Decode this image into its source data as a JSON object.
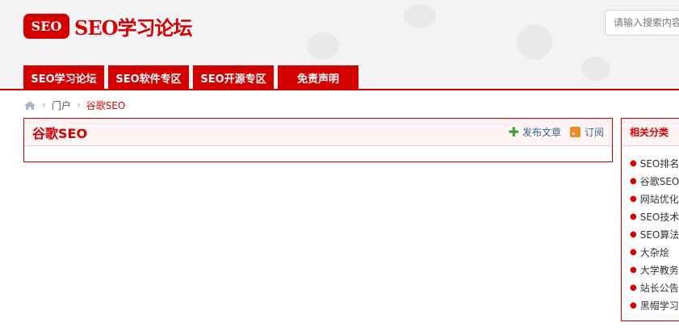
{
  "header": {
    "logo_badge": "SEO",
    "logo_text": "SEO学习论坛",
    "search_placeholder": "请输入搜索内容"
  },
  "nav": {
    "items": [
      {
        "label": "SEO学习论坛"
      },
      {
        "label": "SEO软件专区"
      },
      {
        "label": "SEO开源专区"
      },
      {
        "label": "免责声明"
      }
    ]
  },
  "breadcrumb": {
    "home_icon": "home-icon",
    "items": [
      "门户",
      "谷歌SEO"
    ]
  },
  "main": {
    "title": "谷歌SEO",
    "post_label": "发布文章",
    "subscribe_label": "订阅"
  },
  "sidebar": {
    "title": "相关分类",
    "items": [
      {
        "label": "SEO排名技"
      },
      {
        "label": "谷歌SEO"
      },
      {
        "label": "网站优化"
      },
      {
        "label": "SEO技术"
      },
      {
        "label": "SEO算法"
      },
      {
        "label": "大杂烩"
      },
      {
        "label": "大学教务"
      },
      {
        "label": "站长公告"
      },
      {
        "label": "黑帽学习"
      }
    ]
  },
  "colors": {
    "brand_red": "#d40000",
    "header_bg": "#f3f3f5",
    "link_blue": "#336699"
  }
}
